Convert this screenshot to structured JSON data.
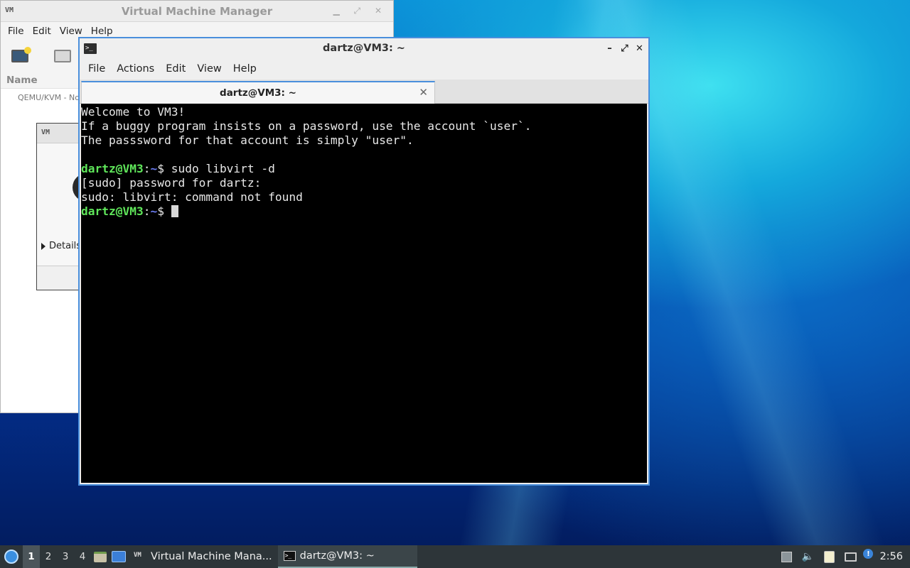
{
  "vmm": {
    "title": "Virtual Machine Manager",
    "menu": [
      "File",
      "Edit",
      "View",
      "Help"
    ],
    "column_name": "Name",
    "connection": "QEMU/KVM - No",
    "dialog_icon": "VM",
    "details_label": "Details"
  },
  "terminal": {
    "title": "dartz@VM3: ~",
    "menu": [
      "File",
      "Actions",
      "Edit",
      "View",
      "Help"
    ],
    "tab_label": "dartz@VM3: ~",
    "output": {
      "line1": "Welcome to VM3!",
      "line2": "If a buggy program insists on a password, use the account `user`.",
      "line3": "The passsword for that account is simply \"user\".",
      "prompt_user": "dartz@VM3",
      "prompt_path": "~",
      "command1": "sudo libvirt -d",
      "line5": "[sudo] password for dartz:",
      "line6": "sudo: libvirt: command not found"
    }
  },
  "taskbar": {
    "workspaces": [
      "1",
      "2",
      "3",
      "4"
    ],
    "active_workspace": "1",
    "tasks": [
      {
        "label": "Virtual Machine Mana...",
        "icon": "virt-manager-icon"
      },
      {
        "label": "dartz@VM3: ~",
        "icon": "terminal-icon"
      }
    ],
    "clock": "2:56",
    "info_badge": "!"
  },
  "icons": {
    "vmm_app": "VM",
    "terminal": ">_"
  },
  "colors": {
    "prompt_user": "#5fe65a",
    "prompt_path": "#6a7bf0",
    "window_accent": "#4a8fdc",
    "taskbar": "#2d3539"
  }
}
